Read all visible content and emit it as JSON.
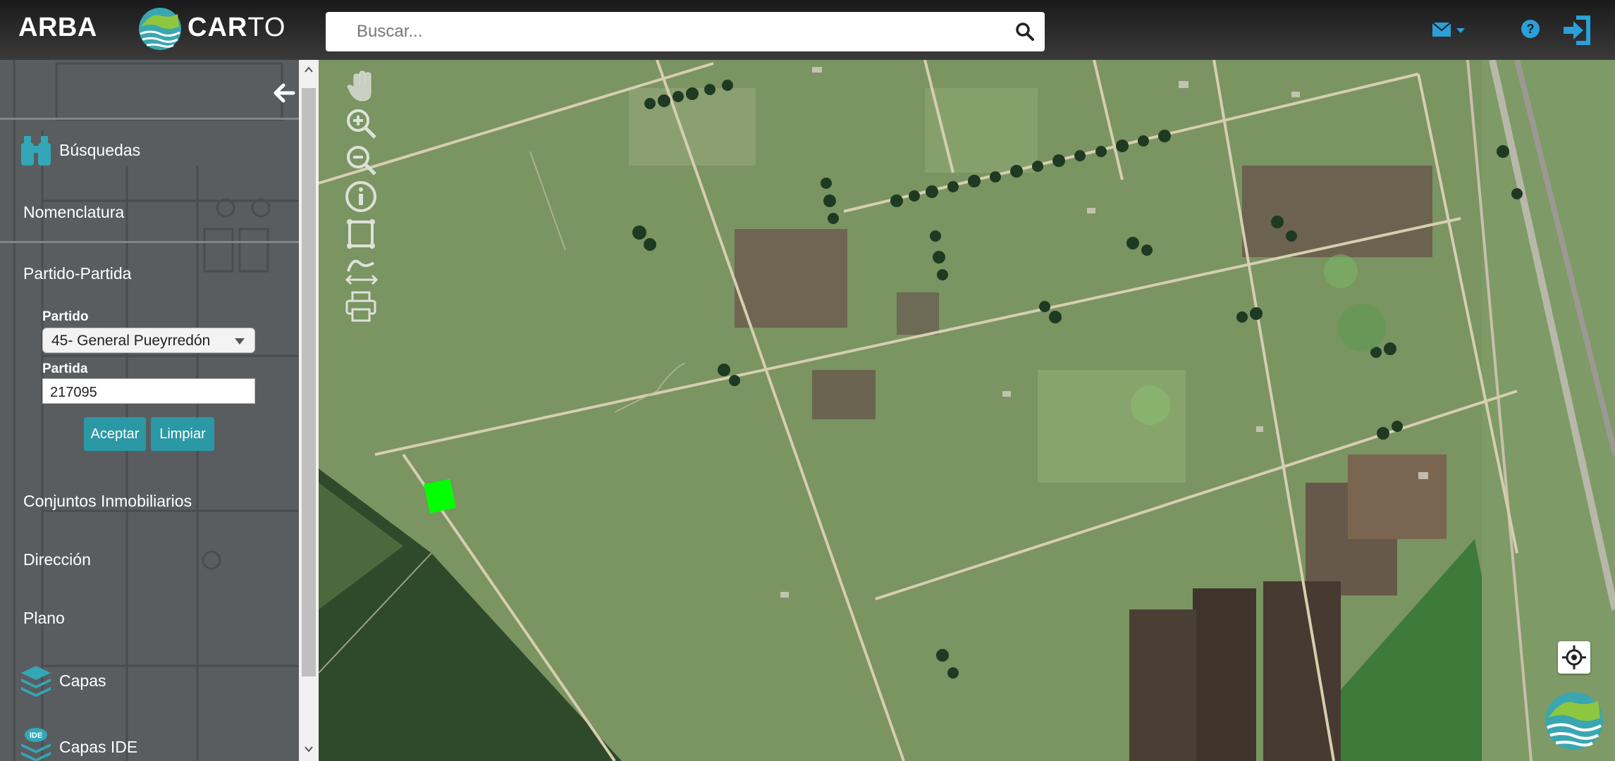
{
  "header": {
    "brand_arba": "ARBA",
    "brand_carto_a": "CAR",
    "brand_carto_b": "TO",
    "search_placeholder": "Buscar..."
  },
  "sidebar": {
    "busquedas_label": "Búsquedas",
    "nomenclatura_label": "Nomenclatura",
    "partido_partida_label": "Partido-Partida",
    "partido_field_label": "Partido",
    "partido_value": "45- General Pueyrredón",
    "partida_field_label": "Partida",
    "partida_value": "217095",
    "aceptar_label": "Aceptar",
    "limpiar_label": "Limpiar",
    "conjuntos_label": "Conjuntos Inmobiliarios",
    "direccion_label": "Dirección",
    "plano_label": "Plano",
    "capas_label": "Capas",
    "capas_ide_label": "Capas IDE",
    "ide_badge": "IDE"
  },
  "map": {
    "tools": [
      "hand-icon",
      "zoom-in-icon",
      "zoom-out-icon",
      "info-icon",
      "measure-area-icon",
      "measure-distance-icon",
      "print-icon"
    ],
    "highlight_color": "#00ff00"
  },
  "colors": {
    "accent": "#2b98a5",
    "header_bg": "#2a2a2a",
    "sidebar_bg": "#5a5d5f"
  }
}
